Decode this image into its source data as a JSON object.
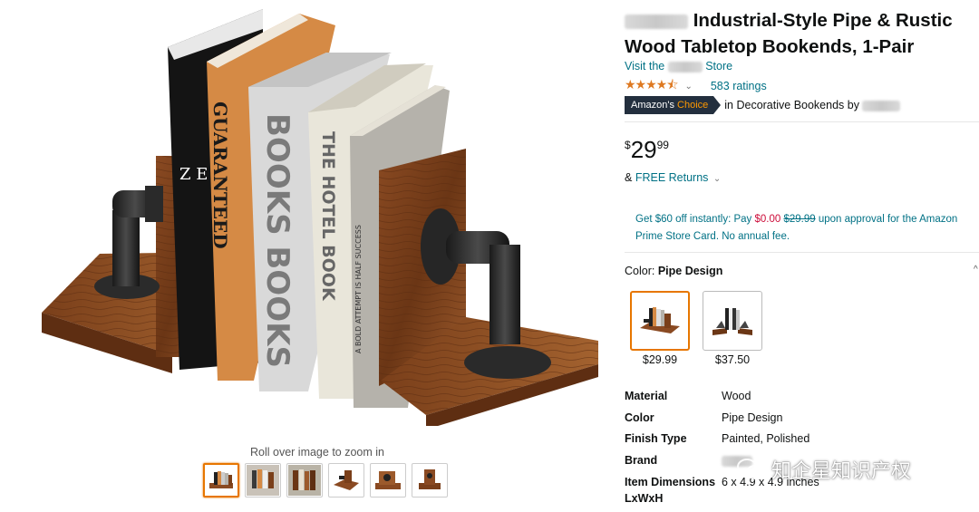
{
  "product": {
    "title_suffix": "Industrial-Style Pipe & Rustic Wood Tabletop Bookends, 1-Pair",
    "store_prefix": "Visit the",
    "store_suffix": "Store",
    "rating_stars": 4.5,
    "ratings_count": "583 ratings",
    "badge_prefix": "Amazon's",
    "badge_highlight": "Choice",
    "choice_category": "in Decorative Bookends by"
  },
  "price": {
    "symbol": "$",
    "whole": "29",
    "fraction": "99"
  },
  "returns": {
    "amp": "&",
    "label": "FREE Returns"
  },
  "promo": {
    "part1": "Get $60 off instantly: Pay",
    "pay": "$0.00",
    "was": "$29.99",
    "part2": "upon approval for the Amazon Prime Store Card. No annual fee."
  },
  "color": {
    "label": "Color:",
    "value": "Pipe Design"
  },
  "variants": [
    {
      "price": "$29.99",
      "selected": true
    },
    {
      "price": "$37.50",
      "selected": false
    }
  ],
  "specs": [
    {
      "key": "Material",
      "value": "Wood"
    },
    {
      "key": "Color",
      "value": "Pipe Design"
    },
    {
      "key": "Finish Type",
      "value": "Painted, Polished"
    },
    {
      "key": "Brand",
      "value": ""
    },
    {
      "key": "Item Dimensions LxWxH",
      "value": "6 x 4.9 x 4.9 inches"
    }
  ],
  "gallery": {
    "zoom_hint": "Roll over image to zoom in",
    "thumbnail_count": 6
  },
  "book_spines": [
    "Z E D",
    "GUARANTEED",
    "BOOKS BOOKS",
    "THE HOTEL BOOK",
    "A BOLD ATTEMPT IS HALF SUCCESS"
  ],
  "watermark": "知企星知识产权",
  "colors": {
    "link": "#007185",
    "star": "#de7921",
    "badge_bg": "#232f3e",
    "badge_accent": "#ff9900",
    "selected_border": "#e77600",
    "promo_red": "#cc0c39"
  }
}
